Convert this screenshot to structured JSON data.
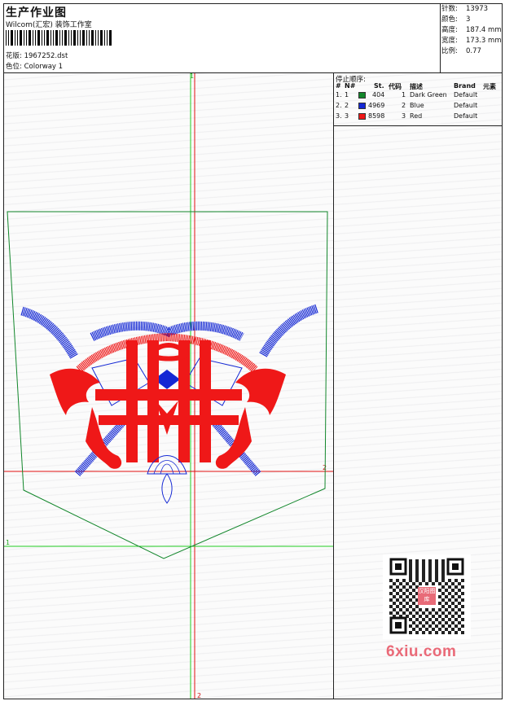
{
  "header": {
    "title": "生产作业图",
    "subtitle": "Wilcom(汇宏) 装饰工作室",
    "design_label": "花版:",
    "design_value": "1967252.dst",
    "colorway_label": "色位:",
    "colorway_value": "Colorway 1"
  },
  "stats": [
    {
      "label": "针数:",
      "value": "13973"
    },
    {
      "label": "颜色:",
      "value": "3"
    },
    {
      "label": "高度:",
      "value": "187.4 mm"
    },
    {
      "label": "宽度:",
      "value": "173.3 mm"
    },
    {
      "label": "比例:",
      "value": "0.77"
    }
  ],
  "stop_sequence": {
    "title": "停止顺序:",
    "columns": [
      "#",
      "N#",
      "St.",
      "代码",
      "描述",
      "Brand",
      "元素"
    ],
    "rows": [
      {
        "idx": "1.",
        "n": "1",
        "st": "404",
        "code": "1",
        "desc": "Dark Green",
        "brand": "Default",
        "color": "#11862a"
      },
      {
        "idx": "2.",
        "n": "2",
        "st": "4969",
        "code": "2",
        "desc": "Blue",
        "brand": "Default",
        "color": "#1428d4"
      },
      {
        "idx": "3.",
        "n": "3",
        "st": "8598",
        "code": "3",
        "desc": "Red",
        "brand": "Default",
        "color": "#ef1818"
      }
    ]
  },
  "guides": {
    "marker_1_top": "1",
    "marker_2_right": "2",
    "marker_1_left": "1",
    "marker_2_bottom": "2"
  },
  "qr": {
    "badge": "汉阳图库"
  },
  "watermark": "6xiu.com",
  "colors": {
    "embroidery_red": "#ef1818",
    "embroidery_blue": "#1428d4",
    "outline_green": "#11862a",
    "guide_green": "#22cc22",
    "guide_red": "#e01010"
  }
}
